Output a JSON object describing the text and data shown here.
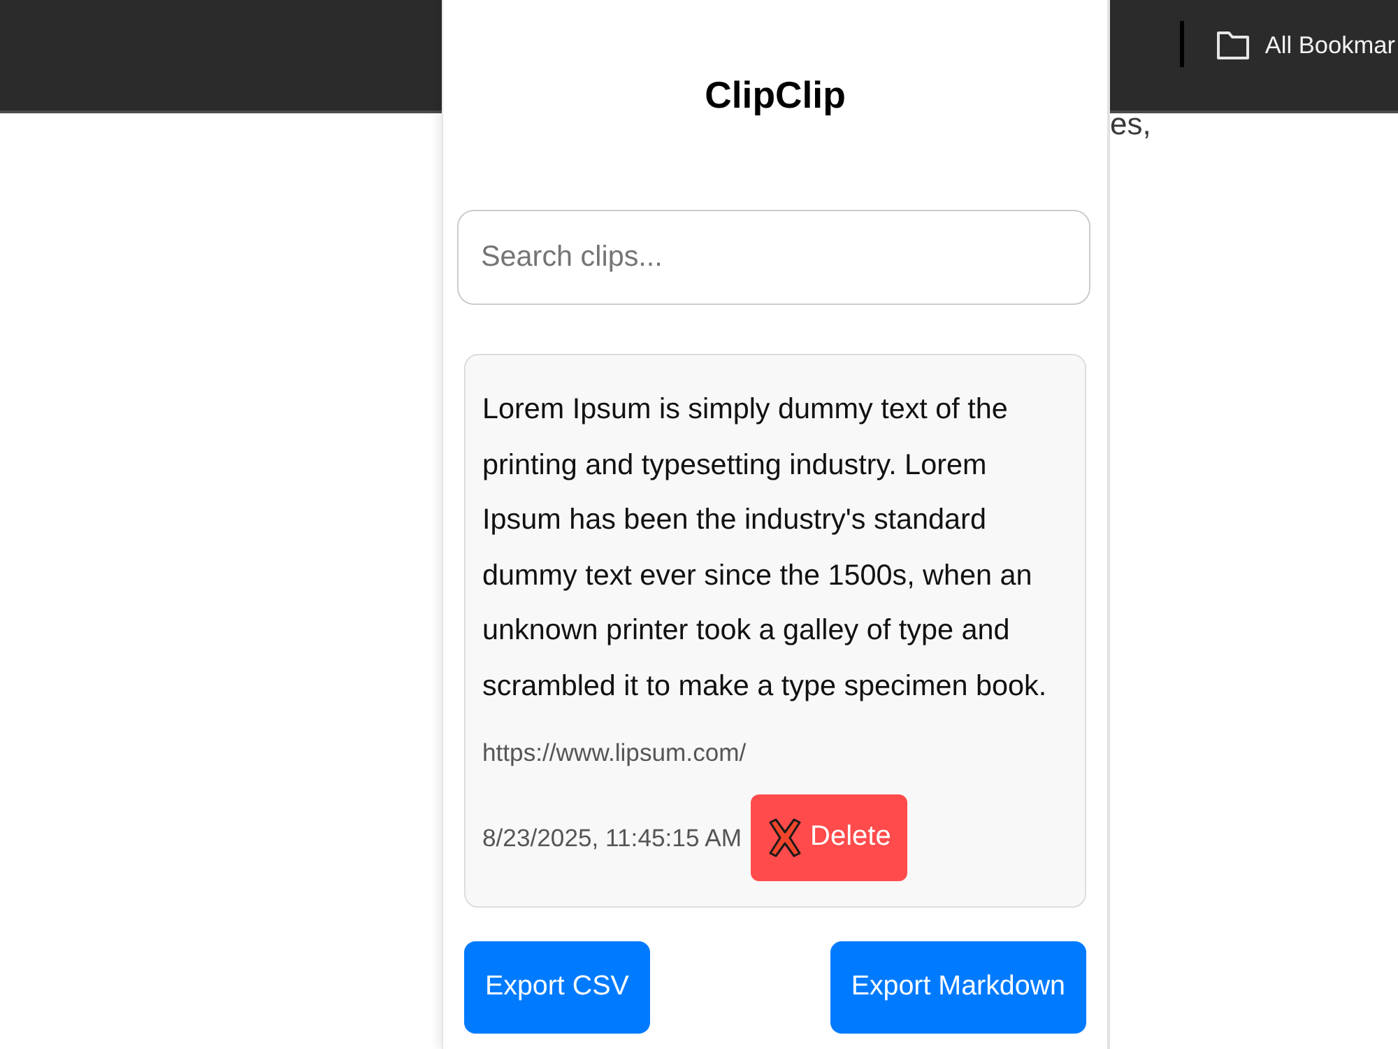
{
  "browser": {
    "bookmarks_button": {
      "label": "All Bookmar"
    },
    "page_text": "es,"
  },
  "popup": {
    "title": "ClipClip",
    "search": {
      "placeholder": "Search clips..."
    },
    "clips": [
      {
        "text": "Lorem Ipsum is simply dummy text of the printing and typesetting industry. Lorem Ipsum has been the industry's standard dummy text ever since the 1500s, when an unknown printer took a galley of type and scrambled it to make a type specimen book.",
        "url": "https://www.lipsum.com/",
        "timestamp": "8/23/2025, 11:45:15 AM",
        "delete_label": "Delete"
      }
    ],
    "buttons": [
      {
        "label": "Export CSV"
      },
      {
        "label": "Export Markdown"
      }
    ]
  }
}
